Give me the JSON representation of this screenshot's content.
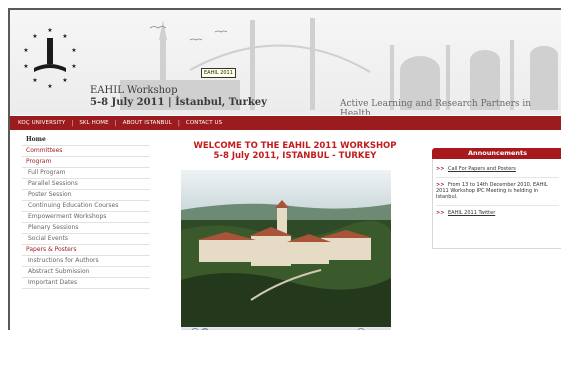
{
  "banner": {
    "workshop_title": "EAHIL Workshop",
    "workshop_dates": "5-8 July 2011 | İstanbul, Turkey",
    "tooltip": "EAHIL 2011",
    "tagline": "Active Learning and Research Partners in Health",
    "logo_number": "1"
  },
  "nav": {
    "items": [
      "KOÇ UNIVERSITY",
      "SKL HOME",
      "ABOUT ISTANBUL",
      "CONTACT US"
    ],
    "separator": "|"
  },
  "sidebar": {
    "items": [
      {
        "label": "Home",
        "type": "home"
      },
      {
        "label": "Committees",
        "type": "sec"
      },
      {
        "label": "Program",
        "type": "sec"
      },
      {
        "label": "Full Program",
        "type": "sub"
      },
      {
        "label": "Parallel Sessions",
        "type": "sub"
      },
      {
        "label": "Poster Session",
        "type": "sub"
      },
      {
        "label": "Continuing Education Courses",
        "type": "sub"
      },
      {
        "label": "Empowerment Workshops",
        "type": "sub"
      },
      {
        "label": "Plenary Sessions",
        "type": "sub"
      },
      {
        "label": "Social Events",
        "type": "sub"
      },
      {
        "label": "Papers & Posters",
        "type": "sec"
      },
      {
        "label": "Instructions for Authors",
        "type": "sub"
      },
      {
        "label": "Abstract Submission",
        "type": "sub"
      },
      {
        "label": "Important Dates",
        "type": "sub"
      }
    ]
  },
  "main": {
    "welcome_line1": "WELCOME TO THE EAHIL 2011 WORKSHOP",
    "welcome_line2": "5-8 July 2011, ISTANBUL - TURKEY"
  },
  "announcements": {
    "title": "Announcements",
    "item1_arrow": ">>",
    "item1": "Call For Papers and Posters",
    "item2_arrow": ">>",
    "item2": "From 13 to 14th December 2010, EAHIL 2011 Workshop IPC Meeting is helding in Istanbul.",
    "item3_arrow": ">>",
    "item3": "EAHIL 2011 Twitter"
  },
  "colors": {
    "brand_red": "#9b1b1e",
    "heading_red": "#c11c1c"
  }
}
